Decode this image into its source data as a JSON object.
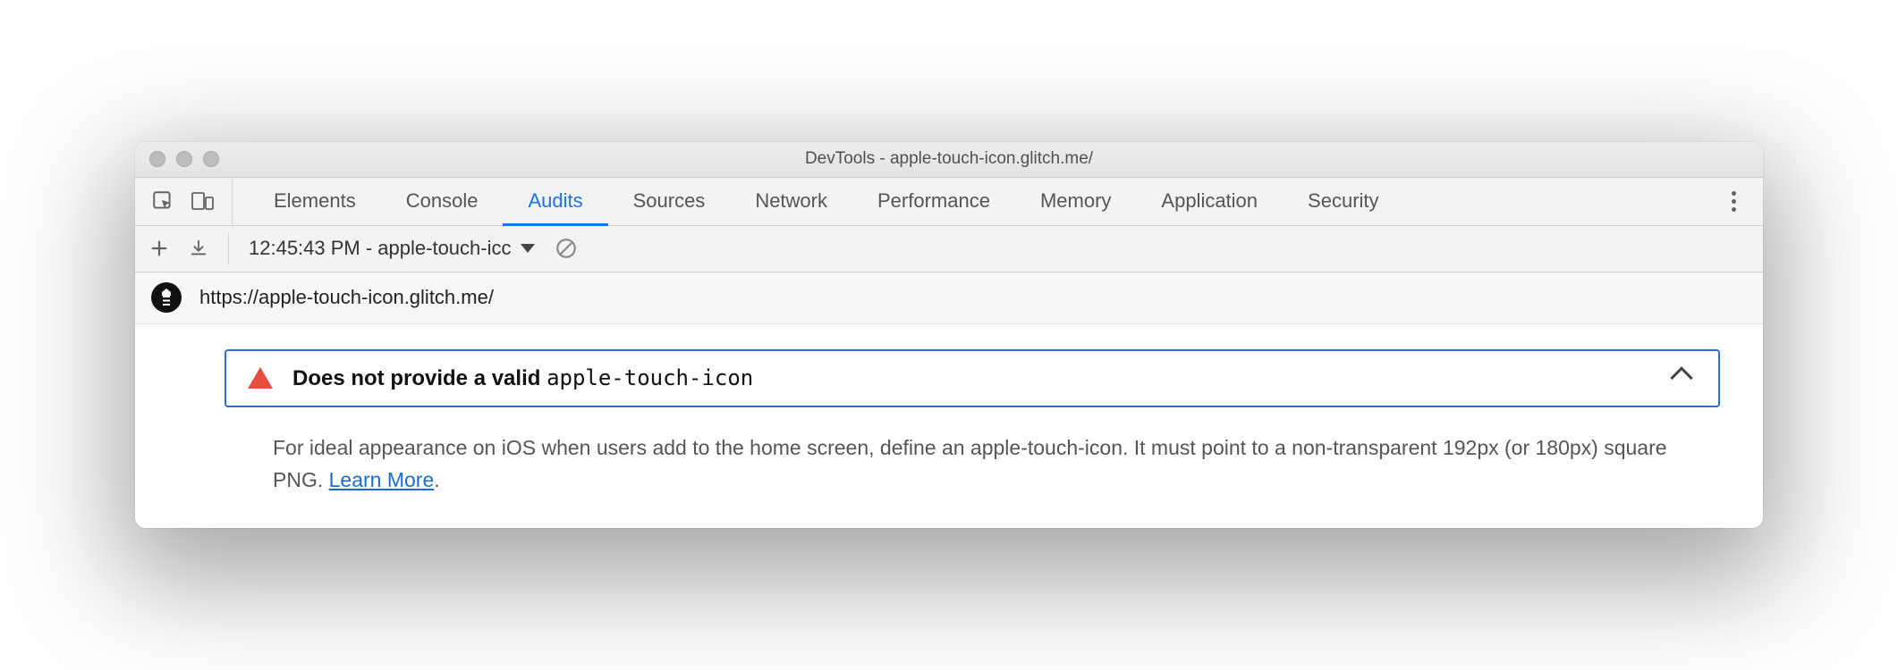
{
  "window": {
    "title": "DevTools - apple-touch-icon.glitch.me/"
  },
  "tabs": [
    {
      "label": "Elements",
      "active": false
    },
    {
      "label": "Console",
      "active": false
    },
    {
      "label": "Audits",
      "active": true
    },
    {
      "label": "Sources",
      "active": false
    },
    {
      "label": "Network",
      "active": false
    },
    {
      "label": "Performance",
      "active": false
    },
    {
      "label": "Memory",
      "active": false
    },
    {
      "label": "Application",
      "active": false
    },
    {
      "label": "Security",
      "active": false
    }
  ],
  "toolbar": {
    "report_label": "12:45:43 PM - apple-touch-icc"
  },
  "urlbar": {
    "url": "https://apple-touch-icon.glitch.me/"
  },
  "audit": {
    "title_prefix": "Does not provide a valid ",
    "title_code": "apple-touch-icon",
    "description_before_link": "For ideal appearance on iOS when users add to the home screen, define an apple-touch-icon. It must point to a non-transparent 192px (or 180px) square PNG. ",
    "learn_more_label": "Learn More",
    "description_after_link": "."
  }
}
